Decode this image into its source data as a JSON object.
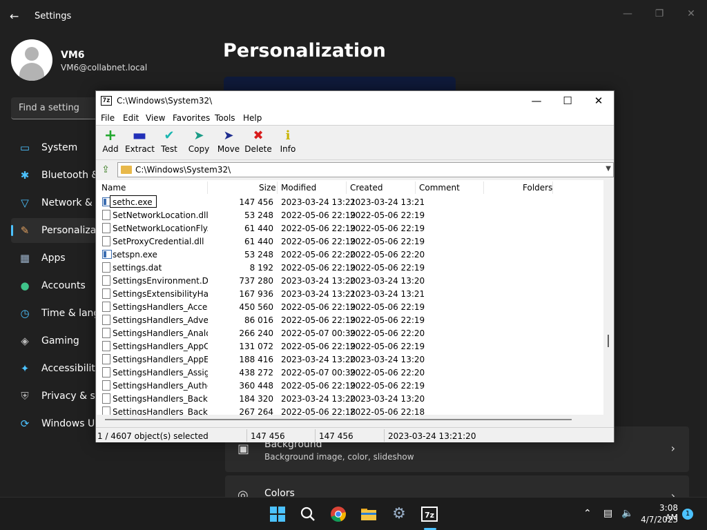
{
  "settings": {
    "title": "Settings",
    "user": {
      "name": "VM6",
      "email": "VM6@collabnet.local"
    },
    "search_placeholder": "Find a setting",
    "nav": [
      {
        "label": "System",
        "icon": "monitor-icon"
      },
      {
        "label": "Bluetooth & devices",
        "icon": "bluetooth-icon"
      },
      {
        "label": "Network & internet",
        "icon": "wifi-icon"
      },
      {
        "label": "Personalization",
        "icon": "brush-icon"
      },
      {
        "label": "Apps",
        "icon": "apps-icon"
      },
      {
        "label": "Accounts",
        "icon": "person-icon"
      },
      {
        "label": "Time & language",
        "icon": "clock-globe-icon"
      },
      {
        "label": "Gaming",
        "icon": "gamepad-icon"
      },
      {
        "label": "Accessibility",
        "icon": "accessibility-icon"
      },
      {
        "label": "Privacy & security",
        "icon": "shield-icon"
      },
      {
        "label": "Windows Update",
        "icon": "update-icon"
      }
    ],
    "page_title": "Personalization",
    "cards": [
      {
        "title": "Background",
        "subtitle": "Background image, color, slideshow"
      },
      {
        "title": "Colors",
        "subtitle": ""
      }
    ]
  },
  "zip": {
    "title": "C:\\Windows\\System32\\",
    "menu": [
      "File",
      "Edit",
      "View",
      "Favorites",
      "Tools",
      "Help"
    ],
    "toolbar": [
      "Add",
      "Extract",
      "Test",
      "Copy",
      "Move",
      "Delete",
      "Info"
    ],
    "address": "C:\\Windows\\System32\\",
    "columns": [
      "Name",
      "Size",
      "Modified",
      "Created",
      "Comment",
      "Folders"
    ],
    "rename_value": "sethc.exe",
    "rows": [
      {
        "name": "sethc.exe",
        "size": "147 456",
        "modified": "2023-03-24 13:21",
        "created": "2023-03-24 13:21",
        "type": "exe"
      },
      {
        "name": "SetNetworkLocation.dll",
        "size": "53 248",
        "modified": "2022-05-06 22:19",
        "created": "2022-05-06 22:19",
        "type": "file"
      },
      {
        "name": "SetNetworkLocationFly...",
        "size": "61 440",
        "modified": "2022-05-06 22:19",
        "created": "2022-05-06 22:19",
        "type": "file"
      },
      {
        "name": "SetProxyCredential.dll",
        "size": "61 440",
        "modified": "2022-05-06 22:19",
        "created": "2022-05-06 22:19",
        "type": "file"
      },
      {
        "name": "setspn.exe",
        "size": "53 248",
        "modified": "2022-05-06 22:20",
        "created": "2022-05-06 22:20",
        "type": "exe"
      },
      {
        "name": "settings.dat",
        "size": "8 192",
        "modified": "2022-05-06 22:19",
        "created": "2022-05-06 22:19",
        "type": "file"
      },
      {
        "name": "SettingsEnvironment.De...",
        "size": "737 280",
        "modified": "2023-03-24 13:20",
        "created": "2023-03-24 13:20",
        "type": "file"
      },
      {
        "name": "SettingsExtensibilityHan...",
        "size": "167 936",
        "modified": "2023-03-24 13:21",
        "created": "2023-03-24 13:21",
        "type": "file"
      },
      {
        "name": "SettingsHandlers_Acces...",
        "size": "450 560",
        "modified": "2022-05-06 22:19",
        "created": "2022-05-06 22:19",
        "type": "file"
      },
      {
        "name": "SettingsHandlers_Adver...",
        "size": "86 016",
        "modified": "2022-05-06 22:19",
        "created": "2022-05-06 22:19",
        "type": "file"
      },
      {
        "name": "SettingsHandlers_Analo...",
        "size": "266 240",
        "modified": "2022-05-07 00:39",
        "created": "2022-05-06 22:20",
        "type": "file"
      },
      {
        "name": "SettingsHandlers_AppC...",
        "size": "131 072",
        "modified": "2022-05-06 22:19",
        "created": "2022-05-06 22:19",
        "type": "file"
      },
      {
        "name": "SettingsHandlers_AppE...",
        "size": "188 416",
        "modified": "2023-03-24 13:20",
        "created": "2023-03-24 13:20",
        "type": "file"
      },
      {
        "name": "SettingsHandlers_Assig...",
        "size": "438 272",
        "modified": "2022-05-07 00:39",
        "created": "2022-05-06 22:20",
        "type": "file"
      },
      {
        "name": "SettingsHandlers_Authe...",
        "size": "360 448",
        "modified": "2022-05-06 22:19",
        "created": "2022-05-06 22:19",
        "type": "file"
      },
      {
        "name": "SettingsHandlers_Backg...",
        "size": "184 320",
        "modified": "2023-03-24 13:20",
        "created": "2023-03-24 13:20",
        "type": "file"
      },
      {
        "name": "SettingsHandlers_Backu...",
        "size": "267 264",
        "modified": "2022-05-06 22:18",
        "created": "2022-05-06 22:18",
        "type": "file"
      }
    ],
    "status": {
      "selection": "1 / 4607 object(s) selected",
      "size": "147 456",
      "packed": "147 456",
      "date": "2023-03-24 13:21:20"
    }
  },
  "taskbar": {
    "apps": [
      "windows-start-icon",
      "search-icon",
      "chrome-icon",
      "file-explorer-icon",
      "settings-gear-icon",
      "7zip-icon"
    ],
    "time": "3:08 AM",
    "date": "4/7/2023",
    "notifications": "1"
  }
}
